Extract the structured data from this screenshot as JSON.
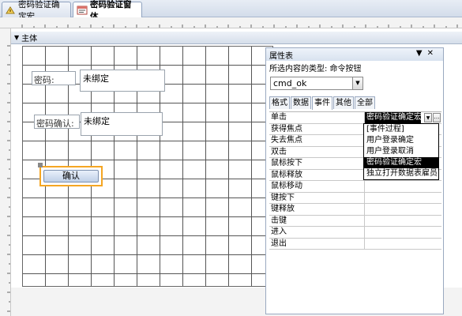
{
  "tabs": [
    {
      "label": "密码验证确定宏",
      "active": false,
      "icon": "macro-icon"
    },
    {
      "label": "密码验证窗体",
      "active": true,
      "icon": "form-icon"
    }
  ],
  "section": {
    "label": "主体"
  },
  "form": {
    "password_label": "密码:",
    "password_field": "未绑定",
    "confirm_label": "密码确认:",
    "confirm_field": "未绑定",
    "button_label": "确认"
  },
  "property_sheet": {
    "title": "属性表",
    "selection_type": "所选内容的类型: 命令按钮",
    "selected_control": "cmd_ok",
    "tabs": [
      "格式",
      "数据",
      "事件",
      "其他",
      "全部"
    ],
    "active_tab": "事件",
    "rows": [
      {
        "name": "单击",
        "value": "密码验证确定宏"
      },
      {
        "name": "获得焦点",
        "value": ""
      },
      {
        "name": "失去焦点",
        "value": ""
      },
      {
        "name": "双击",
        "value": ""
      },
      {
        "name": "鼠标按下",
        "value": ""
      },
      {
        "name": "鼠标释放",
        "value": ""
      },
      {
        "name": "鼠标移动",
        "value": ""
      },
      {
        "name": "键按下",
        "value": ""
      },
      {
        "name": "键释放",
        "value": ""
      },
      {
        "name": "击键",
        "value": ""
      },
      {
        "name": "进入",
        "value": ""
      },
      {
        "name": "退出",
        "value": ""
      }
    ],
    "dropdown_options": [
      "[事件过程]",
      "用户登录确定",
      "用户登录取消",
      "密码验证确定宏",
      "独立打开数据表雇员窗"
    ],
    "dropdown_selected": "密码验证确定宏"
  }
}
